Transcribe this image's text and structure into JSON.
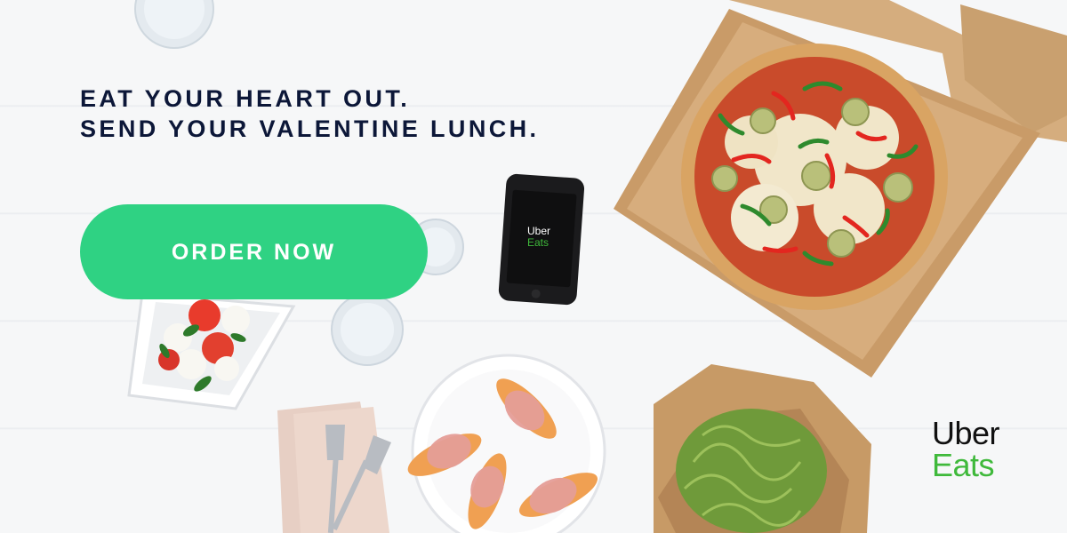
{
  "headline": {
    "line1": "EAT YOUR HEART OUT.",
    "line2": "SEND YOUR VALENTINE LUNCH."
  },
  "cta": {
    "label": "ORDER NOW"
  },
  "brand": {
    "word1": "Uber",
    "word2": "Eats"
  },
  "phone": {
    "word1": "Uber",
    "word2": "Eats"
  },
  "colors": {
    "headline": "#0c1738",
    "cta_bg": "#2fd283",
    "brand_green": "#3fb93b",
    "background": "#f6f7f8"
  },
  "icons": [
    "pizza-box",
    "pizza",
    "phone",
    "water-glass",
    "salad-container",
    "prosciutto-plate",
    "napkin",
    "fork",
    "noodle-box"
  ]
}
